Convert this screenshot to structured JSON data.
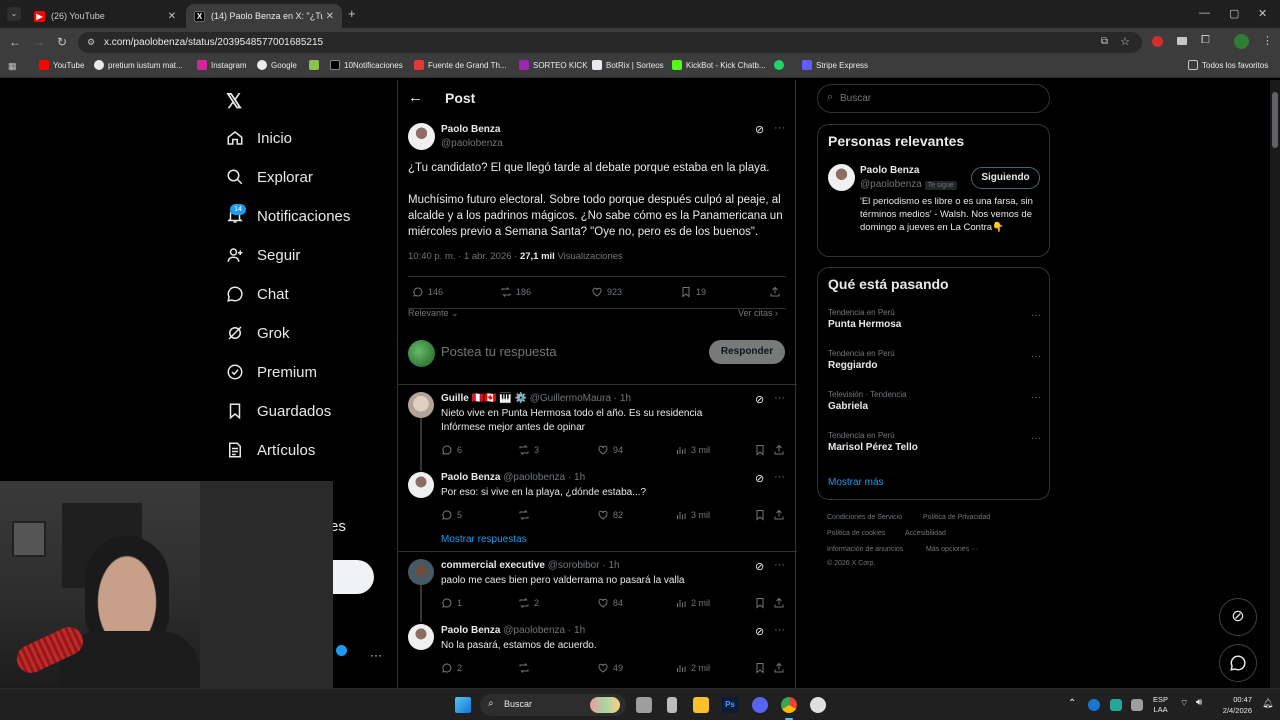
{
  "browser": {
    "tabs": [
      {
        "title": "(26) YouTube"
      },
      {
        "title": "(14) Paolo Benza en X: \"¿Tu can"
      }
    ],
    "url": "x.com/paolobenza/status/2039548577001685215",
    "bookmarks": [
      "YouTube",
      "pretium iustum mat...",
      "Instagram",
      "Google",
      "10Notificaciones",
      "Fuente de Grand Th...",
      "SORTEO KICK",
      "BotRix | Sorteos",
      "KickBot - Kick Chatb...",
      "Stripe Express"
    ],
    "all_bookmarks": "Todos los favoritos"
  },
  "sidebar": {
    "items": [
      {
        "label": "Inicio",
        "icon": "home-icon"
      },
      {
        "label": "Explorar",
        "icon": "search-icon"
      },
      {
        "label": "Notificaciones",
        "icon": "bell-icon",
        "badge": "14"
      },
      {
        "label": "Seguir",
        "icon": "follow-icon"
      },
      {
        "label": "Chat",
        "icon": "chat-icon"
      },
      {
        "label": "Grok",
        "icon": "grok-icon"
      },
      {
        "label": "Premium",
        "icon": "premium-icon"
      },
      {
        "label": "Guardados",
        "icon": "bookmark-icon"
      },
      {
        "label": "Artículos",
        "icon": "articles-icon"
      }
    ],
    "partial_more": "es"
  },
  "post": {
    "header": "Post",
    "author_name": "Paolo Benza",
    "author_handle": "@paolobenza",
    "text_p1": "¿Tu candidato? El que llegó tarde al debate porque estaba en la playa.",
    "text_p2": "Muchísimo futuro electoral. Sobre todo porque después culpó al peaje, al alcalde y a los padrinos mágicos. ¿No sabe cómo es la Panamericana un miércoles previo a Semana Santa? \"Oye no, pero es de los buenos\".",
    "timestamp": "10:40 p. m. · 1 abr. 2026 ·",
    "views_count": "27,1 mil",
    "views_label": "Visualizaciones",
    "replies": "146",
    "reposts": "186",
    "likes": "923",
    "bookmarks": "19",
    "sort_label": "Relevante",
    "quotes_label": "Ver citas",
    "reply_placeholder": "Postea tu respuesta",
    "reply_button": "Responder"
  },
  "replies": [
    {
      "name": "Guille 🇵🇪🇨🇦 🎹 ⚙️",
      "handle": "@GuillermoMaura · 1h",
      "text1": "Nieto vive en Punta Hermosa todo el año. Es su residencia",
      "text2": "Infórmese mejor antes de opinar",
      "replies": "6",
      "reposts": "3",
      "likes": "94",
      "views": "3 mil"
    },
    {
      "name": "Paolo Benza",
      "handle": "@paolobenza · 1h",
      "text1": "Por eso: si vive en la playa, ¿dónde estaba...?",
      "text2": "",
      "replies": "5",
      "reposts": "",
      "likes": "82",
      "views": "3 mil"
    },
    {
      "name": "commercial executive",
      "handle": "@sorobibor · 1h",
      "text1": "paolo me caes bien pero valderrama no pasará la valla",
      "text2": "",
      "replies": "1",
      "reposts": "2",
      "likes": "84",
      "views": "2 mil"
    },
    {
      "name": "Paolo Benza",
      "handle": "@paolobenza · 1h",
      "text1": "No la pasará, estamos de acuerdo.",
      "text2": "",
      "replies": "2",
      "reposts": "",
      "likes": "49",
      "views": "2 mil"
    }
  ],
  "show_replies": "Mostrar respuestas",
  "right": {
    "search_placeholder": "Buscar",
    "relevant_title": "Personas relevantes",
    "relevant_name": "Paolo Benza",
    "relevant_handle": "@paolobenza",
    "follows_you": "Te sigue",
    "following_button": "Siguiendo",
    "bio": "'El periodismo es libre o es una farsa, sin términos medios' - Walsh. Nos vemos de domingo a jueves en La Contra👇",
    "trending_title": "Qué está pasando",
    "trends": [
      {
        "context": "Tendencia en Perú",
        "name": "Punta Hermosa"
      },
      {
        "context": "Tendencia en Perú",
        "name": "Reggiardo"
      },
      {
        "context": "Televisión · Tendencia",
        "name": "Gabriela"
      },
      {
        "context": "Tendencia en Perú",
        "name": "Marisol Pérez Tello"
      }
    ],
    "show_more": "Mostrar más",
    "footer": [
      "Condiciones de Servicio",
      "Política de Privacidad",
      "Política de cookies",
      "Accesibilidad",
      "Información de anuncios",
      "Más opciones ···",
      "© 2026 X Corp."
    ]
  },
  "taskbar": {
    "search": "Buscar",
    "lang1": "ESP",
    "lang2": "LAA",
    "time": "00:47",
    "date": "2/4/2026"
  },
  "colors": {
    "accent": "#1d9bf0",
    "background": "#000000",
    "border": "#2f3336",
    "muted": "#71767b"
  }
}
